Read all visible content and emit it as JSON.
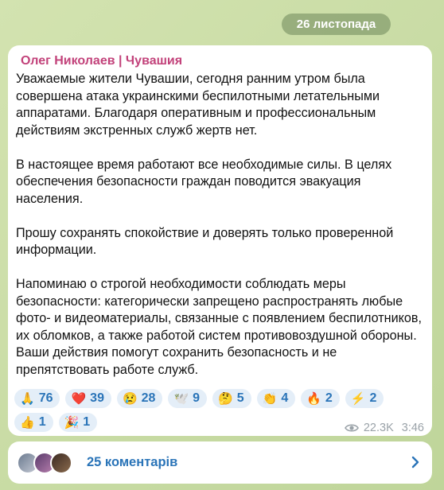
{
  "date_label": "26 листопада",
  "post": {
    "channel": "Олег Николаев | Чувашия",
    "paragraphs": [
      "Уважаемые жители Чувашии, сегодня ранним утром была совершена атака украинскими беспилотными летательными аппаратами. Благодаря оперативным и профессиональным действиям экстренных служб жертв нет.",
      "В настоящее время работают все необходимые силы. В целях обеспечения безопасности граждан поводится эвакуация населения.",
      "Прошу сохранять спокойствие и доверять только проверенной информации.",
      "Напоминаю о строгой необходимости соблюдать меры безопасности: категорически запрещено распространять любые фото- и видеоматериалы, связанные с появлением беспилотников, их обломков, а также работой систем противовоздушной обороны. Ваши действия помогут сохранить безопасность и не препятствовать работе служб."
    ],
    "reactions": [
      {
        "emoji": "🙏",
        "count": "76"
      },
      {
        "emoji": "❤️",
        "count": "39"
      },
      {
        "emoji": "😢",
        "count": "28"
      },
      {
        "emoji": "🕊️",
        "count": "9"
      },
      {
        "emoji": "🤔",
        "count": "5"
      },
      {
        "emoji": "👏",
        "count": "4"
      },
      {
        "emoji": "🔥",
        "count": "2"
      },
      {
        "emoji": "⚡",
        "count": "2"
      },
      {
        "emoji": "👍",
        "count": "1"
      },
      {
        "emoji": "🎉",
        "count": "1"
      }
    ],
    "views": "22.3K",
    "time": "3:46"
  },
  "comments": {
    "label": "25 коментарів"
  }
}
